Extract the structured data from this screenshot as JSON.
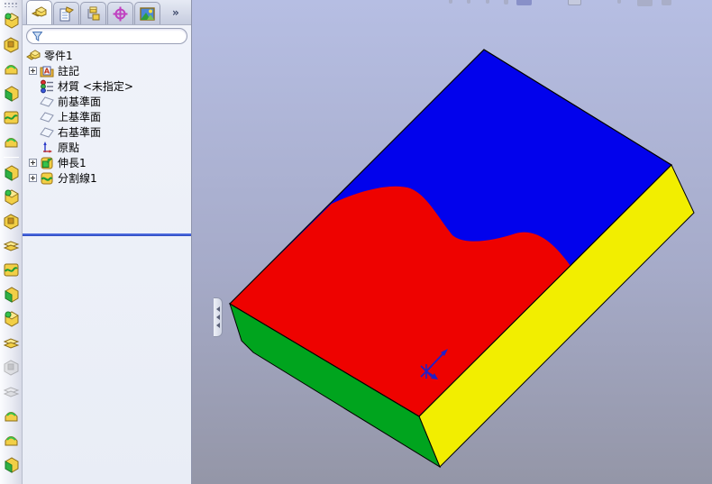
{
  "app": {
    "name": "SolidWorks part document"
  },
  "panel": {
    "tabs_overflow_label": "»",
    "tabs": [
      {
        "name": "featuremanager-design-tree",
        "active": true
      },
      {
        "name": "propertymanager",
        "active": false
      },
      {
        "name": "configurationmanager",
        "active": false
      },
      {
        "name": "dimxpertmanager",
        "active": false
      },
      {
        "name": "displaymanager",
        "active": false
      }
    ],
    "filter": {
      "value": "",
      "placeholder": ""
    }
  },
  "feature_tree": {
    "root_label": "零件1",
    "items": [
      {
        "label": "註記",
        "expandable": true
      },
      {
        "label": "材質 <未指定>",
        "expandable": false
      },
      {
        "label": "前基準面",
        "expandable": false
      },
      {
        "label": "上基準面",
        "expandable": false
      },
      {
        "label": "右基準面",
        "expandable": false
      },
      {
        "label": "原點",
        "expandable": false
      },
      {
        "label": "伸長1",
        "expandable": true
      },
      {
        "label": "分割線1",
        "expandable": true
      }
    ]
  },
  "model": {
    "faces": {
      "top_blue": {
        "color": "#0202EC"
      },
      "split_red": {
        "color": "#EE0200"
      },
      "side_yellow": {
        "color": "#F2EE00"
      },
      "side_green": {
        "color": "#00A41E"
      }
    },
    "edge_color": "#000000",
    "origin_color": "#2020C8"
  },
  "viewport": {
    "bg_top": "#b6bee3",
    "bg_bottom": "#9496a7"
  },
  "rollback_bar_color": "#3355D5"
}
